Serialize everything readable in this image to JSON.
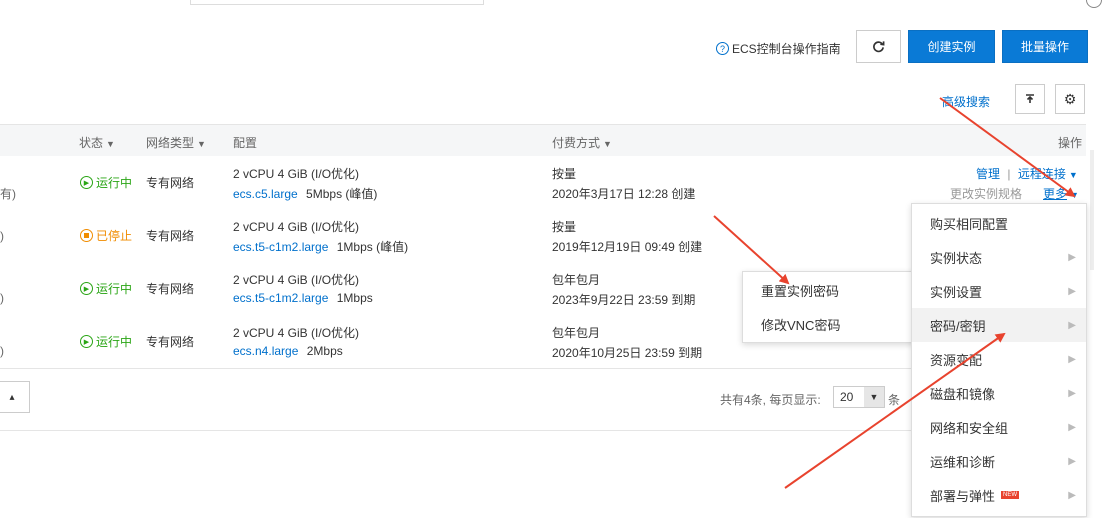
{
  "toolbar": {
    "guide_label": "ECS控制台操作指南",
    "create_label": "创建实例",
    "batch_label": "批量操作",
    "advanced_search": "高级搜索"
  },
  "table": {
    "headers": {
      "status": "状态",
      "network": "网络类型",
      "config": "配置",
      "billing": "付费方式",
      "actions": "操作"
    },
    "rows": [
      {
        "left": "有)",
        "status": "运行中",
        "network": "专有网络",
        "spec": "2 vCPU 4 GiB (I/O优化)",
        "type": "ecs.c5.large",
        "bandwidth": "5Mbps (峰值)",
        "billing": "按量",
        "date": "2020年3月17日 12:28 创建"
      },
      {
        "left": ")",
        "status": "已停止",
        "network": "专有网络",
        "spec": "2 vCPU 4 GiB (I/O优化)",
        "type": "ecs.t5-c1m2.large",
        "bandwidth": "1Mbps (峰值)",
        "billing": "按量",
        "date": "2019年12月19日 09:49 创建"
      },
      {
        "left": ")",
        "status": "运行中",
        "network": "专有网络",
        "spec": "2 vCPU 4 GiB (I/O优化)",
        "type": "ecs.t5-c1m2.large",
        "bandwidth": "1Mbps",
        "billing": "包年包月",
        "date": "2023年9月22日 23:59 到期"
      },
      {
        "left": ")",
        "status": "运行中",
        "network": "专有网络",
        "spec": "2 vCPU 4 GiB (I/O优化)",
        "type": "ecs.n4.large",
        "bandwidth": "2Mbps",
        "billing": "包年包月",
        "date": "2020年10月25日 23:59 到期"
      }
    ],
    "row_actions": {
      "manage": "管理",
      "separator": "|",
      "remote": "远程连接",
      "change_spec": "更改实例规格",
      "more": "更多"
    }
  },
  "pagination": {
    "summary": "共有4条, 每页显示:",
    "page_size": "20",
    "unit": "条"
  },
  "more_menu": [
    "购买相同配置",
    "实例状态",
    "实例设置",
    "密码/密钥",
    "资源变配",
    "磁盘和镜像",
    "网络和安全组",
    "运维和诊断",
    "部署与弹性"
  ],
  "new_badge": "NEW",
  "password_submenu": [
    "重置实例密码",
    "修改VNC密码"
  ],
  "colors": {
    "primary": "#0a7ad6",
    "running": "#2aa515",
    "stopped": "#f08c00",
    "link": "#0070cc",
    "arrow": "#e8432e"
  }
}
